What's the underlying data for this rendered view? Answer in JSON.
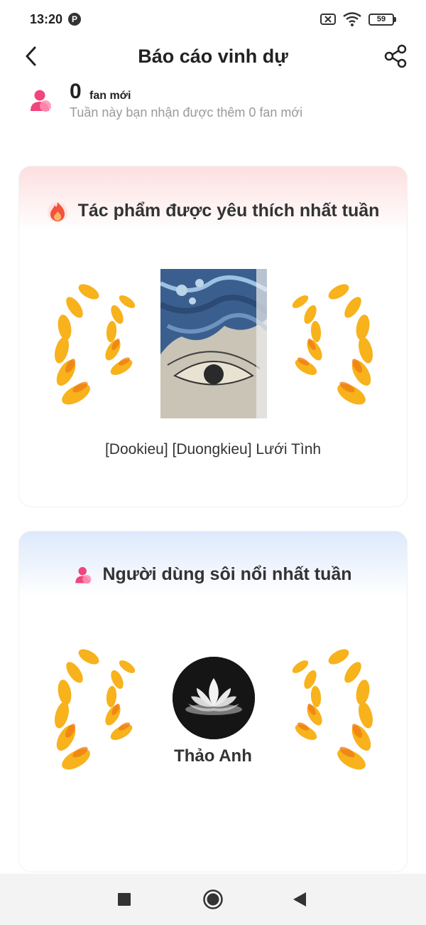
{
  "status_bar": {
    "time": "13:20",
    "battery": "59",
    "icons": [
      "pinterest-icon",
      "sim-off-icon",
      "wifi-icon",
      "battery-icon"
    ]
  },
  "header": {
    "title": "Báo cáo vinh dự",
    "back_icon": "chevron-left-icon",
    "share_icon": "share-icon"
  },
  "fans": {
    "count": "0",
    "label": "fan mới",
    "description": "Tuần này bạn nhận được thêm 0 fan mới"
  },
  "favorite_work": {
    "title": "Tác phẩm được yêu thích nhất tuần",
    "icon": "fire-icon",
    "work_name": "[Dookieu] [Duongkieu] Lưới Tình"
  },
  "active_user": {
    "title": "Người dùng sôi nổi nhất tuần",
    "icon": "user-icon",
    "user_name": "Thảo Anh"
  },
  "nav": {
    "icons": [
      "recents-square-icon",
      "home-circle-icon",
      "back-triangle-icon"
    ]
  },
  "colors": {
    "accent_pink": "#f0457d",
    "laurel_gold": "#f7b21c",
    "laurel_orange": "#f07a12",
    "card1_top": "#fddfe0",
    "card2_top": "#dde9fb"
  }
}
